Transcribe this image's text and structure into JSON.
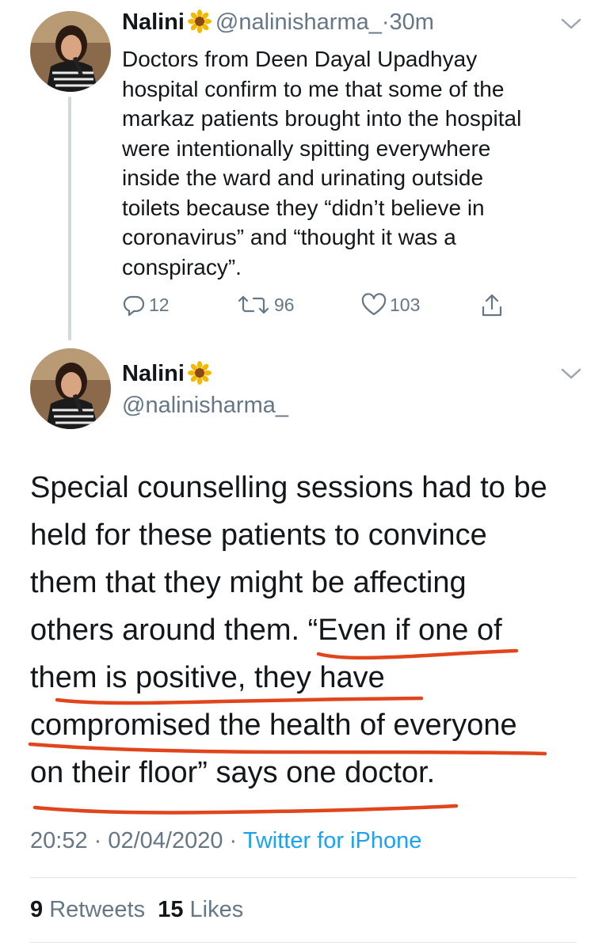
{
  "tweet1": {
    "author_name": "Nalini",
    "handle": "@nalinisharma_",
    "separator": "·",
    "time_ago": "30m",
    "text": "Doctors from Deen Dayal Upadhyay\nhospital confirm to me that some of the\nmarkaz patients brought into the hospital\nwere intentionally spitting everywhere\ninside the ward and urinating outside\ntoilets because they “didn’t believe in\ncoronavirus” and “thought it was a\nconspiracy”.",
    "replies": "12",
    "retweets": "96",
    "likes": "103"
  },
  "tweet2": {
    "author_name": "Nalini",
    "handle": "@nalinisharma_",
    "text": "Special counselling sessions had to be\nheld for these patients to convince\nthem that they might be affecting\nothers around them. “Even if one of\nthem is positive, they have\ncompromised the health of everyone\non their floor” says one doctor.",
    "timestamp": "20:52 · 02/04/2020 ·",
    "source": "Twitter for iPhone",
    "retweet_count": "9",
    "retweet_label": "Retweets",
    "like_count": "15",
    "like_label": "Likes"
  },
  "icons": {
    "verified_emoji": "sunflower-icon",
    "reply": "reply-icon",
    "retweet": "retweet-icon",
    "like": "heart-icon",
    "share": "share-icon",
    "menu": "chevron-down-icon"
  },
  "colors": {
    "text": "#14171a",
    "secondary": "#657786",
    "link": "#1da1f2",
    "annotation": "#e0451b"
  }
}
